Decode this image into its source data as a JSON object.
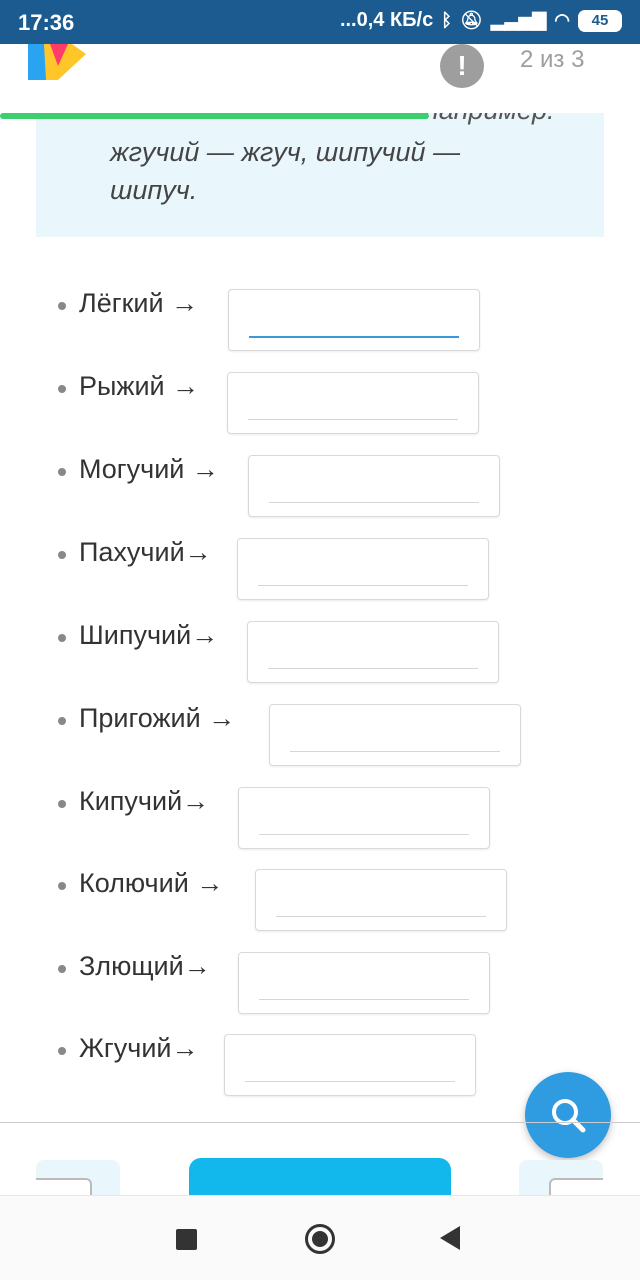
{
  "status_bar": {
    "time": "17:36",
    "network_speed": "...0,4 КБ/с",
    "battery": "45"
  },
  "header": {
    "page_counter": "2 из 3",
    "alert_symbol": "!",
    "progress_fraction": 0.67
  },
  "rule": {
    "partial_line": "например:",
    "text": "жгучий — жгуч, шипучий — шипуч."
  },
  "exercise": {
    "items": [
      {
        "word": "Лёгкий",
        "arrow": "→",
        "value": ""
      },
      {
        "word": "Рыжий",
        "arrow": "→",
        "value": ""
      },
      {
        "word": "Могучий",
        "arrow": "→",
        "value": ""
      },
      {
        "word": "Пахучий",
        "arrow": "→",
        "value": ""
      },
      {
        "word": "Шипучий",
        "arrow": "→",
        "value": ""
      },
      {
        "word": "Пригожий",
        "arrow": "→",
        "value": ""
      },
      {
        "word": "Кипучий",
        "arrow": "→",
        "value": ""
      },
      {
        "word": "Колючий",
        "arrow": "→",
        "value": ""
      },
      {
        "word": "Злющий",
        "arrow": "→",
        "value": ""
      },
      {
        "word": "Жгучий",
        "arrow": "→",
        "value": ""
      }
    ]
  },
  "colors": {
    "status_bar": "#1b5b8f",
    "accent": "#2f9be0",
    "progress": "#3ccf6e",
    "rule_background": "#e9f7fc",
    "primary_button": "#12b8ec"
  },
  "icons": {
    "logo": "logo-icon",
    "alert": "exclamation-icon",
    "search": "search-icon",
    "recents": "square-icon",
    "home": "home-circle-icon",
    "back": "back-triangle-icon"
  }
}
